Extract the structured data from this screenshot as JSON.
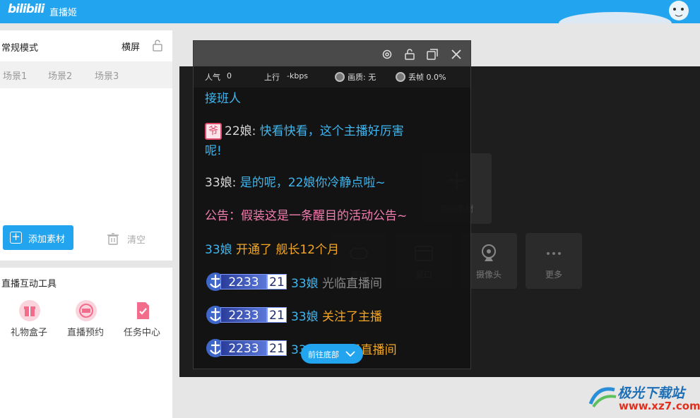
{
  "app": {
    "logo": "bilibili",
    "title": "直播姬"
  },
  "scene_panel": {
    "mode": "常规模式",
    "orientation": "横屏",
    "scenes": [
      "场景1",
      "场景2",
      "场景3"
    ],
    "add_material": "添加素材",
    "clear": "清空"
  },
  "tools": {
    "title": "直播互动工具",
    "items": [
      {
        "label": "礼物盒子",
        "icon": "gift-icon"
      },
      {
        "label": "直播预约",
        "icon": "reservation-icon"
      },
      {
        "label": "任务中心",
        "icon": "task-icon"
      }
    ]
  },
  "preview": {
    "add_material": "添加素材",
    "sources": [
      "游戏",
      "窗口",
      "摄像头",
      "更多"
    ]
  },
  "danmaku": {
    "stats": {
      "popularity_label": "人气",
      "popularity": "0",
      "upload_label": "上行",
      "upload": "-kbps",
      "quality_label": "画质: 无",
      "dropped_label": "丢帧 0.0%"
    },
    "messages": {
      "m1": "接班人",
      "m2_badge": "爷",
      "m2_user": "22娘:",
      "m2_text_1": "快看快看，这个主播好厉害",
      "m2_text_2": "呢!",
      "m3_user": "33娘:",
      "m3_text": "是的呢，22娘你冷静点啦~",
      "m4": "公告：假装这是一条醒目的活动公告~",
      "m5_user": "33娘",
      "m5_text": "开通了 舰长12个月",
      "guard_num": "2233",
      "guard_lvl": "21",
      "m6_user": "33娘",
      "m6_text": "光临直播间",
      "m7_user": "33娘",
      "m7_text": "关注了主播",
      "m8_user": "33",
      "m8_text": "了直播间"
    },
    "go_bottom": "前往底部"
  },
  "watermark": {
    "name": "极光下载站",
    "url": "www.xz7.com"
  },
  "colors": {
    "brand": "#23a4ef",
    "blue_text": "#3fb6ef",
    "orange_text": "#f5a623",
    "pink_text": "#f27eb0"
  }
}
